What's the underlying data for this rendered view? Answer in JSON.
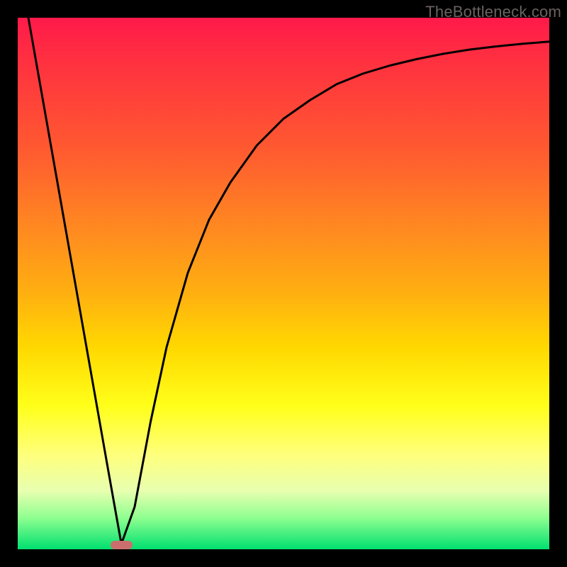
{
  "attribution": "TheBottleneck.com",
  "chart_data": {
    "type": "line",
    "title": "",
    "xlabel": "",
    "ylabel": "",
    "xlim": [
      0,
      100
    ],
    "ylim": [
      0,
      100
    ],
    "grid": false,
    "legend": false,
    "series": [
      {
        "name": "bottleneck-curve",
        "x": [
          2,
          5,
          8,
          11,
          14,
          17,
          19.5,
          22,
          25,
          28,
          32,
          36,
          40,
          45,
          50,
          55,
          60,
          65,
          70,
          75,
          80,
          85,
          90,
          95,
          100
        ],
        "y": [
          100,
          83,
          66,
          49,
          32,
          15,
          1,
          8,
          24,
          38,
          52,
          62,
          69,
          76,
          81,
          84.5,
          87.5,
          89.5,
          91,
          92.2,
          93.2,
          94.0,
          94.6,
          95.1,
          95.5
        ]
      }
    ],
    "marker": {
      "x": 19.5,
      "y": 0,
      "width_pct": 4.2,
      "height_pct": 1.6
    },
    "background_gradient": {
      "top": "#ff1a4a",
      "mid": "#ffff1a",
      "bottom": "#00e070"
    }
  }
}
